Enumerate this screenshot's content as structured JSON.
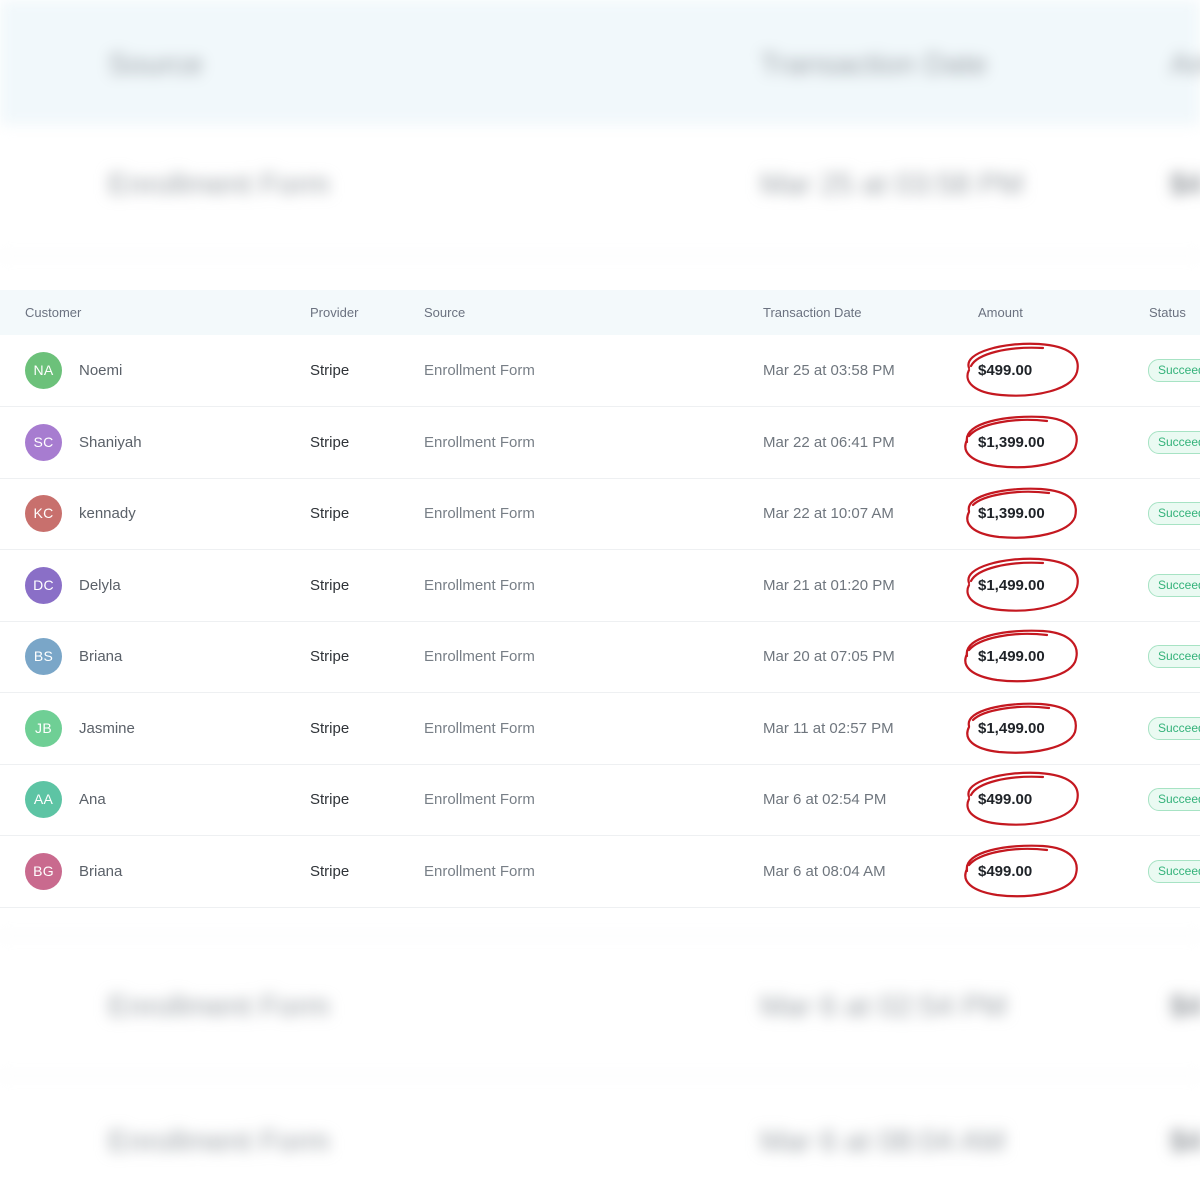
{
  "background": {
    "header_source": "Source",
    "header_date": "Transaction Date",
    "header_amount": "Am",
    "rows": [
      {
        "source": "Enrollment Form",
        "date": "Mar 25 at 03:58 PM",
        "amount": "$4"
      },
      {
        "source": "Enrollment Form",
        "date": "Mar 6 at 02:54 PM",
        "amount": "$4"
      },
      {
        "source": "Enrollment Form",
        "date": "Mar 6 at 08:04 AM",
        "amount": "$4"
      }
    ]
  },
  "table": {
    "headers": {
      "customer": "Customer",
      "provider": "Provider",
      "source": "Source",
      "date": "Transaction Date",
      "amount": "Amount",
      "status": "Status"
    },
    "rows": [
      {
        "initials": "NA",
        "avatar_color": "#6cc17a",
        "name": "Noemi",
        "provider": "Stripe",
        "source": "Enrollment Form",
        "date": "Mar 25 at 03:58 PM",
        "amount": "$499.00",
        "status": "Succeeded"
      },
      {
        "initials": "SC",
        "avatar_color": "#a77cd0",
        "name": "Shaniyah",
        "provider": "Stripe",
        "source": "Enrollment Form",
        "date": "Mar 22 at 06:41 PM",
        "amount": "$1,399.00",
        "status": "Succeeded"
      },
      {
        "initials": "KC",
        "avatar_color": "#c8706d",
        "name": "kennady",
        "provider": "Stripe",
        "source": "Enrollment Form",
        "date": "Mar 22 at 10:07 AM",
        "amount": "$1,399.00",
        "status": "Succeeded"
      },
      {
        "initials": "DC",
        "avatar_color": "#8a6fc7",
        "name": "Delyla",
        "provider": "Stripe",
        "source": "Enrollment Form",
        "date": "Mar 21 at 01:20 PM",
        "amount": "$1,499.00",
        "status": "Succeeded"
      },
      {
        "initials": "BS",
        "avatar_color": "#7aa6c8",
        "name": "Briana",
        "provider": "Stripe",
        "source": "Enrollment Form",
        "date": "Mar 20 at 07:05 PM",
        "amount": "$1,499.00",
        "status": "Succeeded"
      },
      {
        "initials": "JB",
        "avatar_color": "#6fcf95",
        "name": "Jasmine",
        "provider": "Stripe",
        "source": "Enrollment Form",
        "date": "Mar 11 at 02:57 PM",
        "amount": "$1,499.00",
        "status": "Succeeded"
      },
      {
        "initials": "AA",
        "avatar_color": "#5dc4a4",
        "name": "Ana",
        "provider": "Stripe",
        "source": "Enrollment Form",
        "date": "Mar 6 at 02:54 PM",
        "amount": "$499.00",
        "status": "Succeeded"
      },
      {
        "initials": "BG",
        "avatar_color": "#c96a8e",
        "name": "Briana",
        "provider": "Stripe",
        "source": "Enrollment Form",
        "date": "Mar 6 at 08:04 AM",
        "amount": "$499.00",
        "status": "Succeeded"
      }
    ]
  },
  "colors": {
    "annotation_circle": "#c41820",
    "status_green": "#34b27a",
    "header_bg": "#f3f9fb"
  }
}
